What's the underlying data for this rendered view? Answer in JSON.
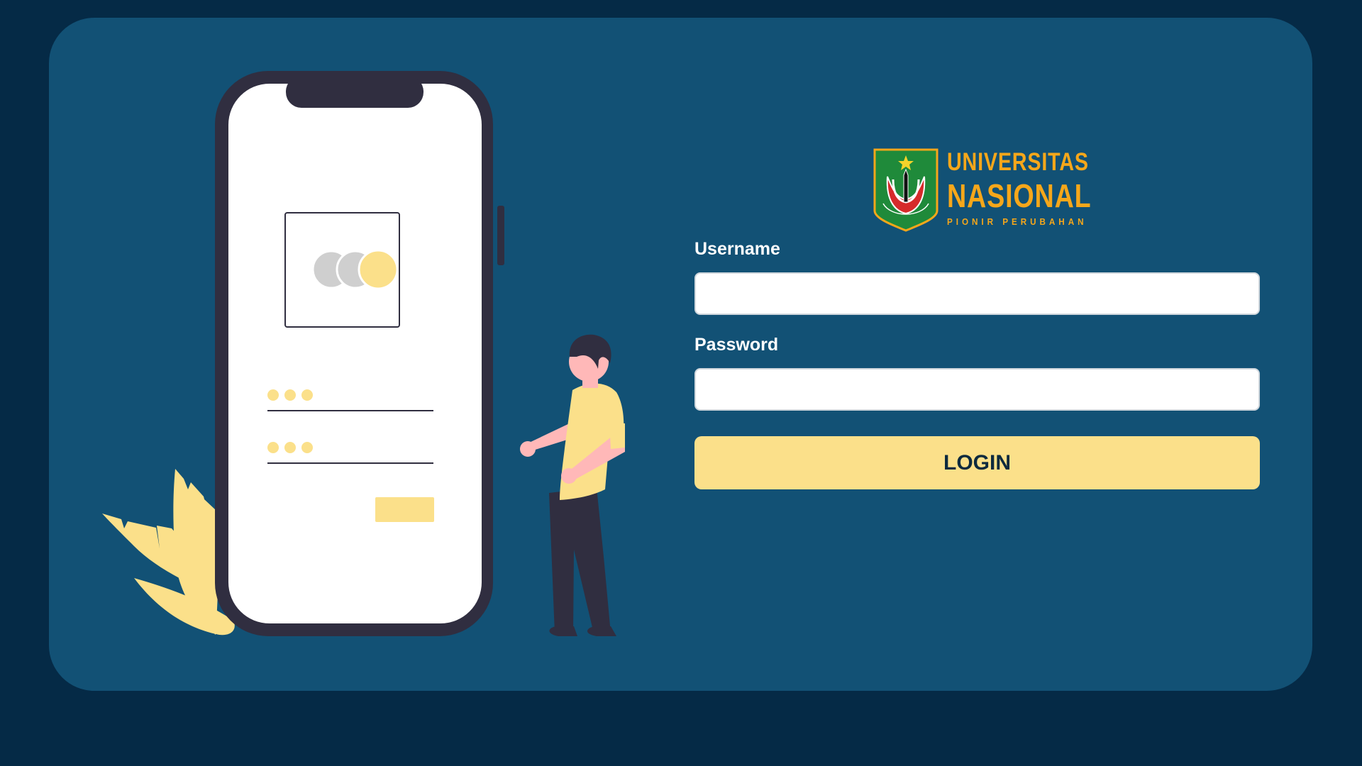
{
  "logo": {
    "line1": "UNIVERSITAS",
    "line2": "NASIONAL",
    "line3": "PIONIR PERUBAHAN",
    "emblem_text": "UNIVERSITAS NASIONAL"
  },
  "form": {
    "username_label": "Username",
    "username_value": "",
    "password_label": "Password",
    "password_value": "",
    "login_label": "LOGIN"
  },
  "colors": {
    "page_background": "#052a46",
    "card_background": "#125175",
    "accent_yellow": "#fbe08a",
    "logo_gold": "#f6a71a",
    "emblem_green": "#1f8a3a",
    "emblem_red": "#d62b2b",
    "illustration_dark": "#302e40"
  },
  "icons": {
    "illustration": "person-with-smartphone-login-illustration",
    "logo": "universitas-nasional-shield-emblem"
  }
}
